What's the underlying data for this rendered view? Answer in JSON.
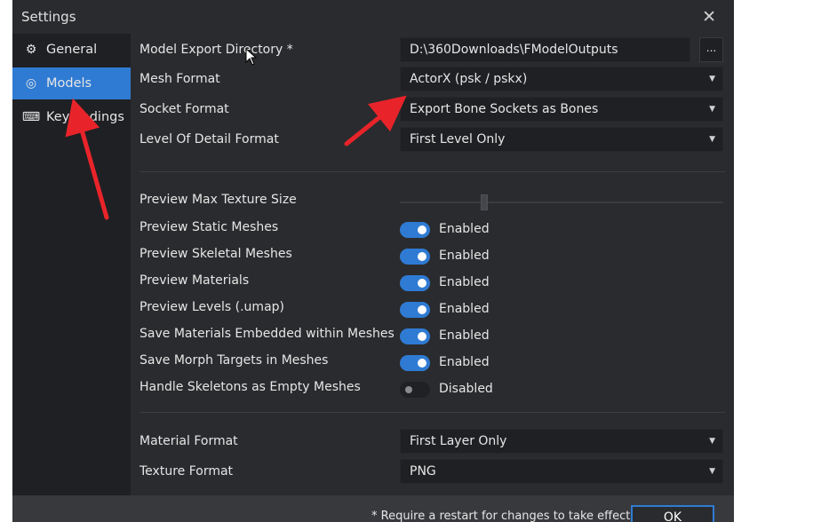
{
  "window": {
    "title": "Settings",
    "close_glyph": "✕"
  },
  "sidebar": {
    "items": [
      {
        "label": "General",
        "icon": "gear-icon",
        "glyph": "⚙",
        "active": false
      },
      {
        "label": "Models",
        "icon": "model-icon",
        "glyph": "◎",
        "active": true
      },
      {
        "label": "Keybindings",
        "icon": "keyboard-icon",
        "glyph": "⌨",
        "active": false
      }
    ]
  },
  "settings": {
    "export_dir": {
      "label": "Model Export Directory *",
      "value": "D:\\360Downloads\\FModelOutputs",
      "browse": "..."
    },
    "mesh_format": {
      "label": "Mesh Format",
      "value": "ActorX (psk / pskx)"
    },
    "socket_format": {
      "label": "Socket Format",
      "value": "Export Bone Sockets as Bones"
    },
    "lod_format": {
      "label": "Level Of Detail Format",
      "value": "First Level Only"
    },
    "preview_max_texture": {
      "label": "Preview Max Texture Size",
      "level": 0.26
    },
    "toggles": [
      {
        "label": "Preview Static Meshes",
        "state": "Enabled",
        "on": true
      },
      {
        "label": "Preview Skeletal Meshes",
        "state": "Enabled",
        "on": true
      },
      {
        "label": "Preview Materials",
        "state": "Enabled",
        "on": true
      },
      {
        "label": "Preview Levels (.umap)",
        "state": "Enabled",
        "on": true
      },
      {
        "label": "Save Materials Embedded within Meshes",
        "state": "Enabled",
        "on": true
      },
      {
        "label": "Save Morph Targets in Meshes",
        "state": "Enabled",
        "on": true
      },
      {
        "label": "Handle Skeletons as Empty Meshes",
        "state": "Disabled",
        "on": false
      }
    ],
    "material_format": {
      "label": "Material Format",
      "value": "First Layer Only"
    },
    "texture_format": {
      "label": "Texture Format",
      "value": "PNG"
    }
  },
  "footer": {
    "note": "* Require a restart for changes to take effect",
    "ok_label": "OK"
  },
  "dropdown_glyph": "▼",
  "colors": {
    "accent": "#2f7bd3",
    "background": "#2a2b2e",
    "sidebar": "#1f2023",
    "annotation": "#e8242a"
  }
}
